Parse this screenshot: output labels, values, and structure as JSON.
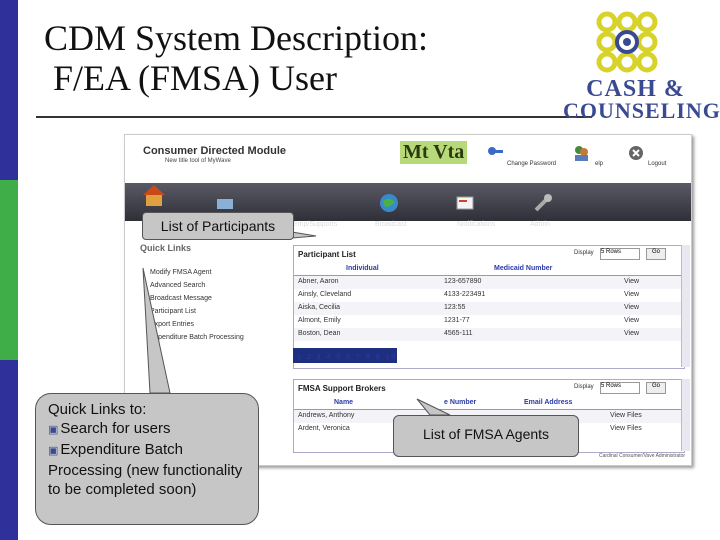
{
  "slide": {
    "title_line1": "CDM System Description:",
    "title_line2": " F/EA (FMSA) User",
    "colors": {
      "edge_blue": "#30309a",
      "edge_green": "#3fae49",
      "logo": "#3a4a92"
    }
  },
  "logo": {
    "line1": "CASH &",
    "line2": "COUNSELING"
  },
  "app": {
    "title": "Consumer Directed Module",
    "subtitle": "New title tool of MyWave",
    "brand": "Mt Vta",
    "toolbar": {
      "change_password": "Change Password",
      "help": "elp",
      "logout": "Logout"
    },
    "nav": [
      "Emp/Supports",
      "Broadcast",
      "Notifications",
      "Admin"
    ],
    "quick_links_heading": "Quick Links",
    "quick_links": [
      "Modify FMSA Agent",
      "Advanced Search",
      "Broadcast Message",
      "Participant List",
      "Export Entries",
      "Expenditure Batch Processing"
    ],
    "participant_list": {
      "title": "Participant List",
      "display_label": "Display",
      "display_value": "5 Rows",
      "go_label": "Go",
      "columns": [
        "Individual",
        "Medicaid Number"
      ],
      "rows": [
        {
          "name": "Abner, Aaron",
          "num": "123-657890",
          "action": "View"
        },
        {
          "name": "Ainsly, Cleveland",
          "num": "4133-223491",
          "action": "View"
        },
        {
          "name": "Aiska, Cecilia",
          "num": "123:55",
          "action": "View"
        },
        {
          "name": "Almont, Emily",
          "num": "1231-77",
          "action": "View"
        },
        {
          "name": "Boston, Dean",
          "num": "4565-111",
          "action": "View"
        }
      ],
      "pager": "1 2 3 4 5 6 7 8 9 10"
    },
    "fmsa_brokers": {
      "title": "FMSA Support Brokers",
      "display_label": "Display",
      "display_value": "5 Rows",
      "go_label": "Go",
      "columns": [
        "Name",
        "e Number",
        "Email Address"
      ],
      "rows": [
        {
          "name": "Andrews, Anthony",
          "action": "View Files"
        },
        {
          "name": "Ardent, Veronica",
          "action": "View Files"
        }
      ]
    },
    "footnote": "Cardinal Consumer/Vave Administrator"
  },
  "callouts": {
    "participants": "List of Participants",
    "fmsa": "List of FMSA Agents",
    "quick_intro": "Quick Links to:",
    "quick_item1": "Search for users",
    "quick_item2": "Expenditure Batch Processing (new functionality to be completed soon)"
  }
}
